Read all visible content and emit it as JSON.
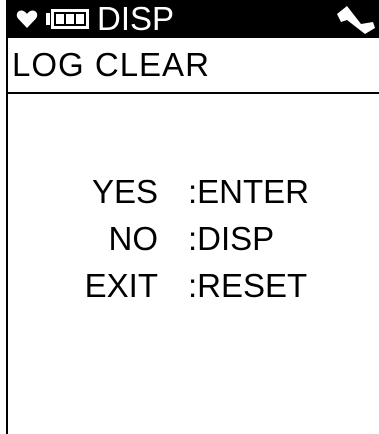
{
  "status_bar": {
    "mode": "DISP",
    "icons": [
      "heart-icon",
      "battery-icon",
      "signal-icon"
    ]
  },
  "screen": {
    "title": "LOG CLEAR"
  },
  "options": [
    {
      "key": "YES",
      "action": ":ENTER"
    },
    {
      "key": "NO",
      "action": ":DISP"
    },
    {
      "key": "EXIT",
      "action": ":RESET"
    }
  ],
  "colors": {
    "background": "#ffffff",
    "foreground": "#000000",
    "header_bg": "#000000",
    "header_fg": "#ffffff"
  }
}
